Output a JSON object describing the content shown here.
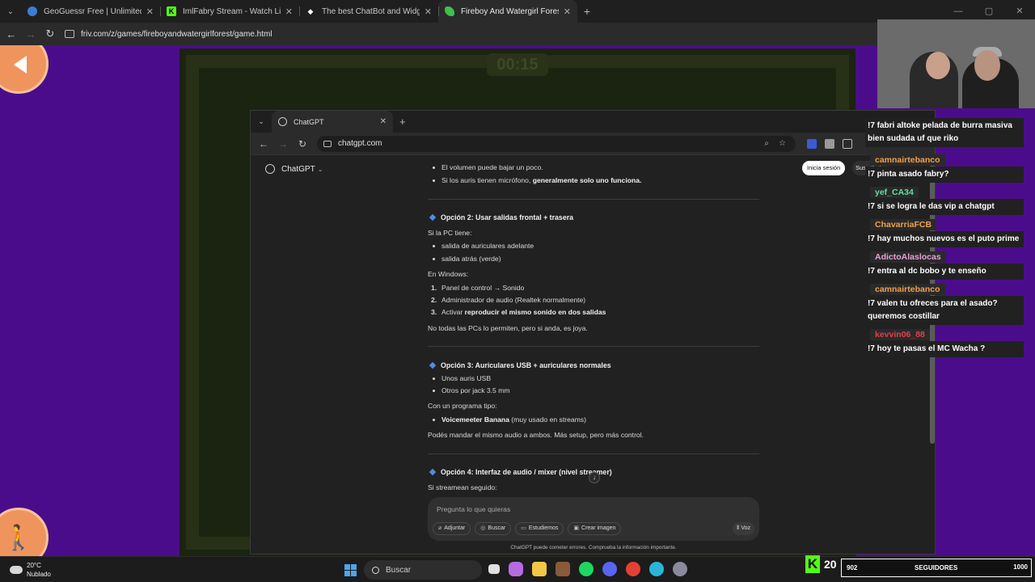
{
  "outer_browser": {
    "tabs": [
      {
        "title": "GeoGuessr Free | Unlimited Mo",
        "fav": "globe-icon",
        "color": "#3d7bd9"
      },
      {
        "title": "ImlFabry Stream - Watch Live o",
        "fav": "kick-logo",
        "color": "#53fc18"
      },
      {
        "title": "The best ChatBot and Widgets",
        "fav": "diamond-icon",
        "color": "#ffffff"
      },
      {
        "title": "Fireboy And Watergirl Forest Te",
        "fav": "leaf-icon",
        "color": "#3cc14a"
      }
    ],
    "url": "friv.com/z/games/fireboyandwatergirlforest/game.html"
  },
  "game": {
    "timer": "00:15"
  },
  "chatgpt": {
    "tab_title": "ChatGPT",
    "url": "chatgpt.com",
    "brand": "ChatGPT",
    "login": "Inicia sesión",
    "signup": "Suscríbete",
    "content": {
      "l1": "El volumen puede bajar un poco.",
      "l2a": "Si los auris tienen micrófono, ",
      "l2b": "generalmente solo uno funciona.",
      "h2": "Opción 2: Usar salidas frontal + trasera",
      "p1": "Si la PC tiene:",
      "b1": "salida de auriculares adelante",
      "b2": "salida atrás (verde)",
      "p2": "En Windows:",
      "n1": "Panel de control → Sonido",
      "n2": "Administrador de audio (Realtek normalmente)",
      "n3a": "Activar ",
      "n3b": "reproducir el mismo sonido en dos salidas",
      "p3": "No todas las PCs lo permiten, pero si anda, es joya.",
      "h3": "Opción 3: Auriculares USB + auriculares normales",
      "b3": "Unos auris USB",
      "b4": "Otros por jack 3.5 mm",
      "p4": "Con un programa tipo:",
      "b5a": "Voicemeeter Banana",
      "b5b": " (muy usado en streams)",
      "p5": "Podés mandar el mismo audio a ambos. Más setup, pero más control.",
      "h4": "Opción 4: Interfaz de audio / mixer (nivel streamer)",
      "p6": "Si streamean seguido:"
    },
    "composer": {
      "placeholder": "Pregunta lo que quieras",
      "attach": "Adjuntar",
      "search": "Buscar",
      "study": "Estudiemos",
      "image": "Crear imagen",
      "voice": "Voz"
    },
    "disclaimer": "ChatGPT puede cometer errores. Comprueba la información importante."
  },
  "chat": [
    {
      "user": "",
      "text": "!7 fabri altoke pelada de burra masiva bien sudada uf que riko",
      "color": "#ffffff"
    },
    {
      "user": "camnairtebanco",
      "text": "!7 pinta asado fabry?",
      "color": "#f0a04b"
    },
    {
      "user": "yef_CA34",
      "text": "!7 si se logra le das vip a chatgpt",
      "color": "#5ee0a0"
    },
    {
      "user": "ChavarriaFCB",
      "text": "!7 hay muchos nuevos es el puto prime",
      "color": "#f0a04b"
    },
    {
      "user": "AdictoAlaslocas",
      "text": "!7 entra al dc bobo y te enseño",
      "color": "#e8a0d8"
    },
    {
      "user": "camnairtebanco",
      "text": "!7 valen tu ofreces para el asado? queremos costillar",
      "color": "#f0a04b"
    },
    {
      "user": "kevvin06_88",
      "text": "!7 hoy te pasas el MC Wacha ?",
      "color": "#e0404a"
    }
  ],
  "taskbar": {
    "temp": "20°C",
    "condition": "Nublado",
    "search": "Buscar"
  },
  "stream": {
    "viewers": "20",
    "followers": "902",
    "followers_label": "SEGUIDORES",
    "followers_goal": "1000"
  }
}
